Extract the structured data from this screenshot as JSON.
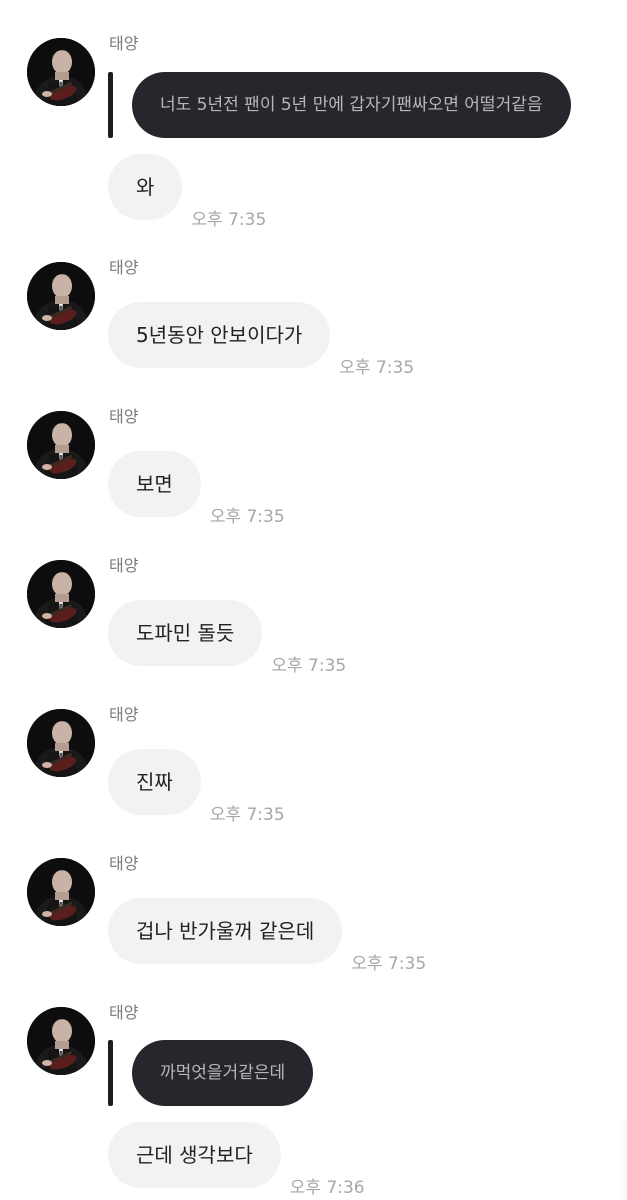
{
  "sender_name": "태양",
  "messages": [
    {
      "quote": "너도 5년전 팬이 5년 만에 갑자기팬싸오면 어떨거같음",
      "text": "와",
      "time": "오후 7:35"
    },
    {
      "text": "5년동안 안보이다가",
      "time": "오후 7:35"
    },
    {
      "text": "보면",
      "time": "오후 7:35"
    },
    {
      "text": "도파민 돌듯",
      "time": "오후 7:35"
    },
    {
      "text": "진짜",
      "time": "오후 7:35"
    },
    {
      "text": "겁나 반가울꺼 같은데",
      "time": "오후 7:35"
    },
    {
      "quote": "까먹엇을거같은데",
      "text": "근데 생각보다",
      "time": "오후 7:36"
    }
  ],
  "colors": {
    "incoming_bubble": "#f2f2f5",
    "quote_bubble": "#26262c",
    "quote_text": "#b6b6bb",
    "timestamp": "#a6a6ab",
    "sender_name": "#7b7b7b"
  },
  "icons": {
    "avatar": "profile-photo-avatar"
  }
}
